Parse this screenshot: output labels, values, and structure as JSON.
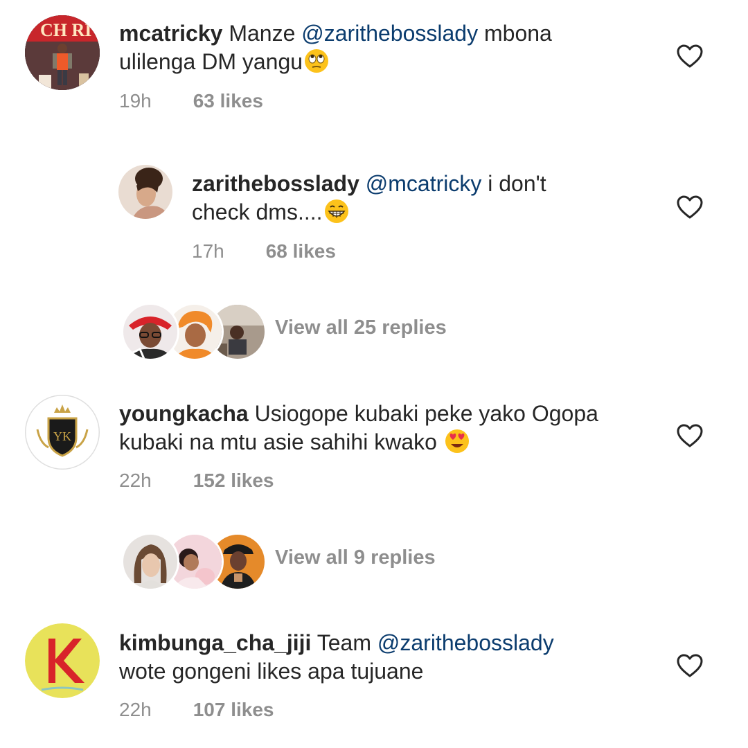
{
  "comments": [
    {
      "username": "mcatricky",
      "parts": [
        {
          "t": "Manze "
        },
        {
          "t": "@zarithebosslady",
          "mention": true
        },
        {
          "t": " mbona"
        }
      ],
      "line2": "ulilenga DM yangu",
      "emoji": "face-with-rolling-eyes",
      "time": "19h",
      "likes": "63 likes",
      "avatar_text": "CH RI"
    },
    {
      "username": "zarithebosslady",
      "mention": "@mcatricky",
      "line1_rest": " i don't",
      "line2": "check dms....",
      "emoji": "grinning-face",
      "time": "17h",
      "likes": "68 likes"
    },
    {
      "username": "youngkacha",
      "line1_rest": " Usiogope kubaki peke yako Ogopa",
      "line2": "kubaki na mtu asie sahihi kwako ",
      "emoji": "heart-eyes-face",
      "time": "22h",
      "likes": "152 likes",
      "avatar_text": "YK"
    },
    {
      "username": "kimbunga_cha_jiji",
      "line1_rest": " Team ",
      "mention": "@zarithebosslady",
      "line2": "wote gongeni likes apa tujuane",
      "time": "22h",
      "likes": "107 likes",
      "avatar_text": "K"
    }
  ],
  "reply_threads": [
    {
      "label": "View all 25 replies"
    },
    {
      "label": "View all 9 replies"
    }
  ],
  "colors": {
    "text": "#262626",
    "muted": "#8e8e8e",
    "mention": "#0b3c6e"
  }
}
